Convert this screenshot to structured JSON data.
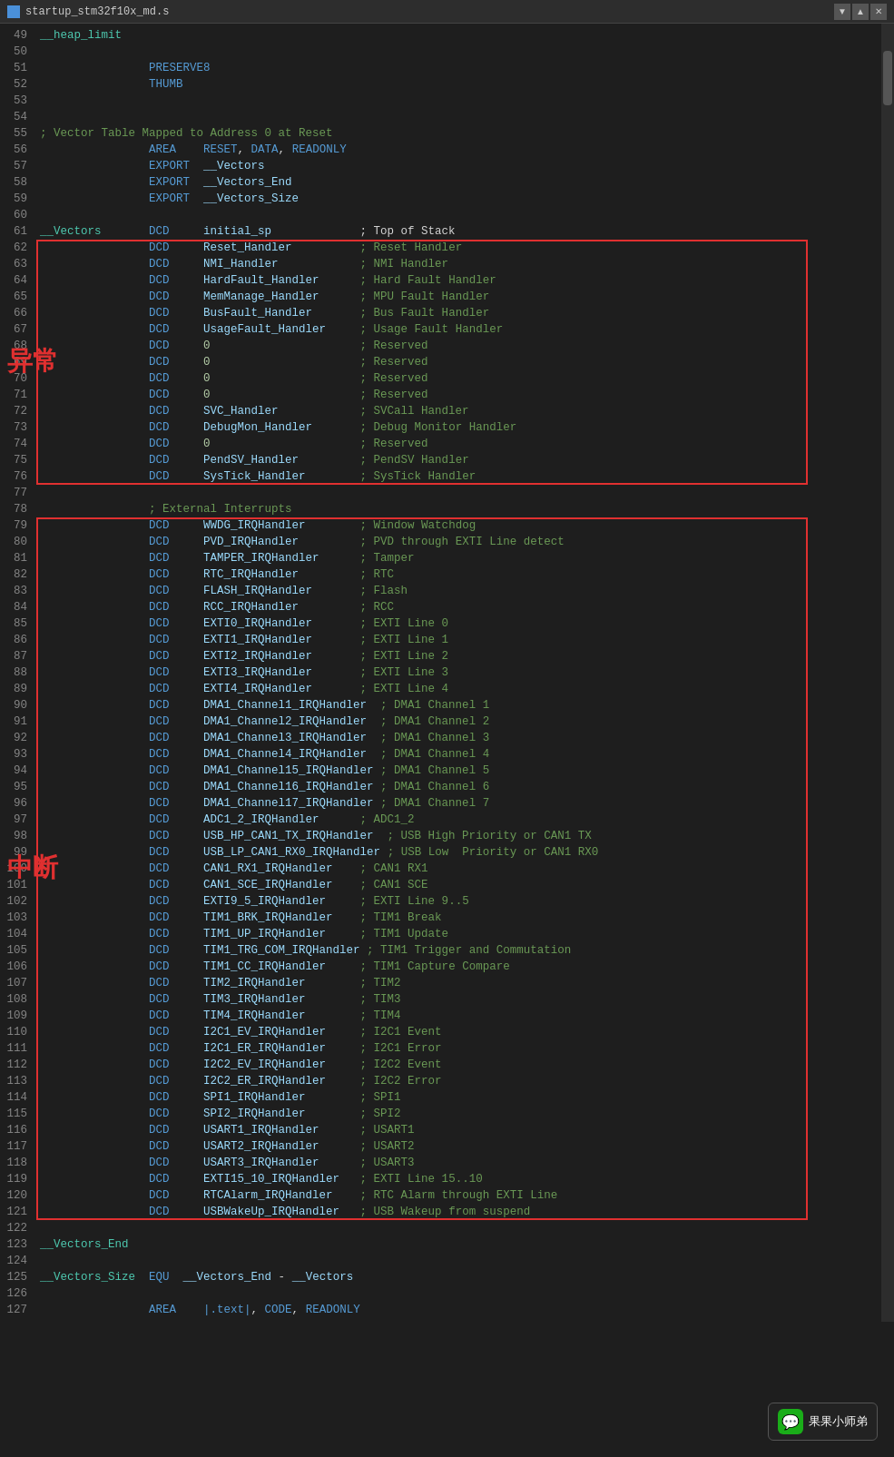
{
  "titlebar": {
    "filename": "startup_stm32f10x_md.s",
    "controls": [
      "▼",
      "▲",
      "✕"
    ]
  },
  "watermark": {
    "label": "果果小师弟",
    "icon": "💬"
  },
  "annotations": [
    {
      "id": "exception-box",
      "label": "异常"
    },
    {
      "id": "interrupt-box",
      "label": "中断"
    }
  ],
  "lines": [
    {
      "num": 49,
      "content": "__heap_limit",
      "type": "label-line"
    },
    {
      "num": 50,
      "content": ""
    },
    {
      "num": 51,
      "content": "                PRESERVE8",
      "type": "preserve"
    },
    {
      "num": 52,
      "content": "                THUMB",
      "type": "preserve"
    },
    {
      "num": 53,
      "content": ""
    },
    {
      "num": 54,
      "content": ""
    },
    {
      "num": 55,
      "content": "; Vector Table Mapped to Address 0 at Reset",
      "type": "comment"
    },
    {
      "num": 56,
      "content": "                AREA    RESET, DATA, READONLY",
      "type": "keyword"
    },
    {
      "num": 57,
      "content": "                EXPORT  __Vectors",
      "type": "keyword"
    },
    {
      "num": 58,
      "content": "                EXPORT  __Vectors_End",
      "type": "keyword"
    },
    {
      "num": 59,
      "content": "                EXPORT  __Vectors_Size",
      "type": "keyword"
    },
    {
      "num": 60,
      "content": ""
    },
    {
      "num": 61,
      "content": "__Vectors       DCD     initial_sp             ; Top of Stack",
      "type": "mixed"
    },
    {
      "num": 62,
      "content": "                DCD     Reset_Handler          ; Reset Handler",
      "type": "mixed",
      "boxStart": "exception"
    },
    {
      "num": 63,
      "content": "                DCD     NMI_Handler            ; NMI Handler",
      "type": "mixed"
    },
    {
      "num": 64,
      "content": "                DCD     HardFault_Handler      ; Hard Fault Handler",
      "type": "mixed"
    },
    {
      "num": 65,
      "content": "                DCD     MemManage_Handler      ; MPU Fault Handler",
      "type": "mixed"
    },
    {
      "num": 66,
      "content": "                DCD     BusFault_Handler       ; Bus Fault Handler",
      "type": "mixed"
    },
    {
      "num": 67,
      "content": "                DCD     UsageFault_Handler     ; Usage Fault Handler",
      "type": "mixed"
    },
    {
      "num": 68,
      "content": "                DCD     0                      ; Reserved",
      "type": "mixed"
    },
    {
      "num": 69,
      "content": "                DCD     0                      ; Reserved",
      "type": "mixed"
    },
    {
      "num": 70,
      "content": "                DCD     0                      ; Reserved",
      "type": "mixed"
    },
    {
      "num": 71,
      "content": "                DCD     0                      ; Reserved",
      "type": "mixed"
    },
    {
      "num": 72,
      "content": "                DCD     SVC_Handler            ; SVCall Handler",
      "type": "mixed"
    },
    {
      "num": 73,
      "content": "                DCD     DebugMon_Handler       ; Debug Monitor Handler",
      "type": "mixed"
    },
    {
      "num": 74,
      "content": "                DCD     0                      ; Reserved",
      "type": "mixed"
    },
    {
      "num": 75,
      "content": "                DCD     PendSV_Handler         ; PendSV Handler",
      "type": "mixed"
    },
    {
      "num": 76,
      "content": "                DCD     SysTick_Handler        ; SysTick Handler",
      "type": "mixed",
      "boxEnd": "exception"
    },
    {
      "num": 77,
      "content": ""
    },
    {
      "num": 78,
      "content": "                ; External Interrupts",
      "type": "comment"
    },
    {
      "num": 79,
      "content": "                DCD     WWDG_IRQHandler        ; Window Watchdog",
      "type": "mixed",
      "boxStart": "interrupt"
    },
    {
      "num": 80,
      "content": "                DCD     PVD_IRQHandler         ; PVD through EXTI Line detect",
      "type": "mixed"
    },
    {
      "num": 81,
      "content": "                DCD     TAMPER_IRQHandler      ; Tamper",
      "type": "mixed"
    },
    {
      "num": 82,
      "content": "                DCD     RTC_IRQHandler         ; RTC",
      "type": "mixed"
    },
    {
      "num": 83,
      "content": "                DCD     FLASH_IRQHandler       ; Flash",
      "type": "mixed"
    },
    {
      "num": 84,
      "content": "                DCD     RCC_IRQHandler         ; RCC",
      "type": "mixed"
    },
    {
      "num": 85,
      "content": "                DCD     EXTI0_IRQHandler       ; EXTI Line 0",
      "type": "mixed"
    },
    {
      "num": 86,
      "content": "                DCD     EXTI1_IRQHandler       ; EXTI Line 1",
      "type": "mixed"
    },
    {
      "num": 87,
      "content": "                DCD     EXTI2_IRQHandler       ; EXTI Line 2",
      "type": "mixed"
    },
    {
      "num": 88,
      "content": "                DCD     EXTI3_IRQHandler       ; EXTI Line 3",
      "type": "mixed"
    },
    {
      "num": 89,
      "content": "                DCD     EXTI4_IRQHandler       ; EXTI Line 4",
      "type": "mixed"
    },
    {
      "num": 90,
      "content": "                DCD     DMA1_Channel1_IRQHandler  ; DMA1 Channel 1",
      "type": "mixed"
    },
    {
      "num": 91,
      "content": "                DCD     DMA1_Channel2_IRQHandler  ; DMA1 Channel 2",
      "type": "mixed"
    },
    {
      "num": 92,
      "content": "                DCD     DMA1_Channel3_IRQHandler  ; DMA1 Channel 3",
      "type": "mixed"
    },
    {
      "num": 93,
      "content": "                DCD     DMA1_Channel4_IRQHandler  ; DMA1 Channel 4",
      "type": "mixed"
    },
    {
      "num": 94,
      "content": "                DCD     DMA1_Channel15_IRQHandler ; DMA1 Channel 5",
      "type": "mixed"
    },
    {
      "num": 95,
      "content": "                DCD     DMA1_Channel16_IRQHandler ; DMA1 Channel 6",
      "type": "mixed"
    },
    {
      "num": 96,
      "content": "                DCD     DMA1_Channel17_IRQHandler ; DMA1 Channel 7",
      "type": "mixed"
    },
    {
      "num": 97,
      "content": "                DCD     ADC1_2_IRQHandler      ; ADC1_2",
      "type": "mixed"
    },
    {
      "num": 98,
      "content": "                DCD     USB_HP_CAN1_TX_IRQHandler  ; USB High Priority or CAN1 TX",
      "type": "mixed"
    },
    {
      "num": 99,
      "content": "                DCD     USB_LP_CAN1_RX0_IRQHandler ; USB Low  Priority or CAN1 RX0",
      "type": "mixed"
    },
    {
      "num": 100,
      "content": "                DCD     CAN1_RX1_IRQHandler    ; CAN1 RX1",
      "type": "mixed"
    },
    {
      "num": 101,
      "content": "                DCD     CAN1_SCE_IRQHandler    ; CAN1 SCE",
      "type": "mixed"
    },
    {
      "num": 102,
      "content": "                DCD     EXTI9_5_IRQHandler     ; EXTI Line 9..5",
      "type": "mixed"
    },
    {
      "num": 103,
      "content": "                DCD     TIM1_BRK_IRQHandler    ; TIM1 Break",
      "type": "mixed"
    },
    {
      "num": 104,
      "content": "                DCD     TIM1_UP_IRQHandler     ; TIM1 Update",
      "type": "mixed"
    },
    {
      "num": 105,
      "content": "                DCD     TIM1_TRG_COM_IRQHandler ; TIM1 Trigger and Commutation",
      "type": "mixed"
    },
    {
      "num": 106,
      "content": "                DCD     TIM1_CC_IRQHandler     ; TIM1 Capture Compare",
      "type": "mixed"
    },
    {
      "num": 107,
      "content": "                DCD     TIM2_IRQHandler        ; TIM2",
      "type": "mixed"
    },
    {
      "num": 108,
      "content": "                DCD     TIM3_IRQHandler        ; TIM3",
      "type": "mixed"
    },
    {
      "num": 109,
      "content": "                DCD     TIM4_IRQHandler        ; TIM4",
      "type": "mixed"
    },
    {
      "num": 110,
      "content": "                DCD     I2C1_EV_IRQHandler     ; I2C1 Event",
      "type": "mixed"
    },
    {
      "num": 111,
      "content": "                DCD     I2C1_ER_IRQHandler     ; I2C1 Error",
      "type": "mixed"
    },
    {
      "num": 112,
      "content": "                DCD     I2C2_EV_IRQHandler     ; I2C2 Event",
      "type": "mixed"
    },
    {
      "num": 113,
      "content": "                DCD     I2C2_ER_IRQHandler     ; I2C2 Error",
      "type": "mixed"
    },
    {
      "num": 114,
      "content": "                DCD     SPI1_IRQHandler        ; SPI1",
      "type": "mixed"
    },
    {
      "num": 115,
      "content": "                DCD     SPI2_IRQHandler        ; SPI2",
      "type": "mixed"
    },
    {
      "num": 116,
      "content": "                DCD     USART1_IRQHandler      ; USART1",
      "type": "mixed"
    },
    {
      "num": 117,
      "content": "                DCD     USART2_IRQHandler      ; USART2",
      "type": "mixed"
    },
    {
      "num": 118,
      "content": "                DCD     USART3_IRQHandler      ; USART3",
      "type": "mixed"
    },
    {
      "num": 119,
      "content": "                DCD     EXTI15_10_IRQHandler   ; EXTI Line 15..10",
      "type": "mixed"
    },
    {
      "num": 120,
      "content": "                DCD     RTCAlarm_IRQHandler    ; RTC Alarm through EXTI Line",
      "type": "mixed"
    },
    {
      "num": 121,
      "content": "                DCD     USBWakeUp_IRQHandler   ; USB Wakeup from suspend",
      "type": "mixed",
      "boxEnd": "interrupt"
    },
    {
      "num": 122,
      "content": ""
    },
    {
      "num": 123,
      "content": "__Vectors_End",
      "type": "label-line"
    },
    {
      "num": 124,
      "content": ""
    },
    {
      "num": 125,
      "content": "__Vectors_Size  EQU  __Vectors_End - __Vectors",
      "type": "mixed"
    },
    {
      "num": 126,
      "content": ""
    },
    {
      "num": 127,
      "content": "                AREA    |.text|, CODE, READONLY",
      "type": "keyword"
    }
  ]
}
